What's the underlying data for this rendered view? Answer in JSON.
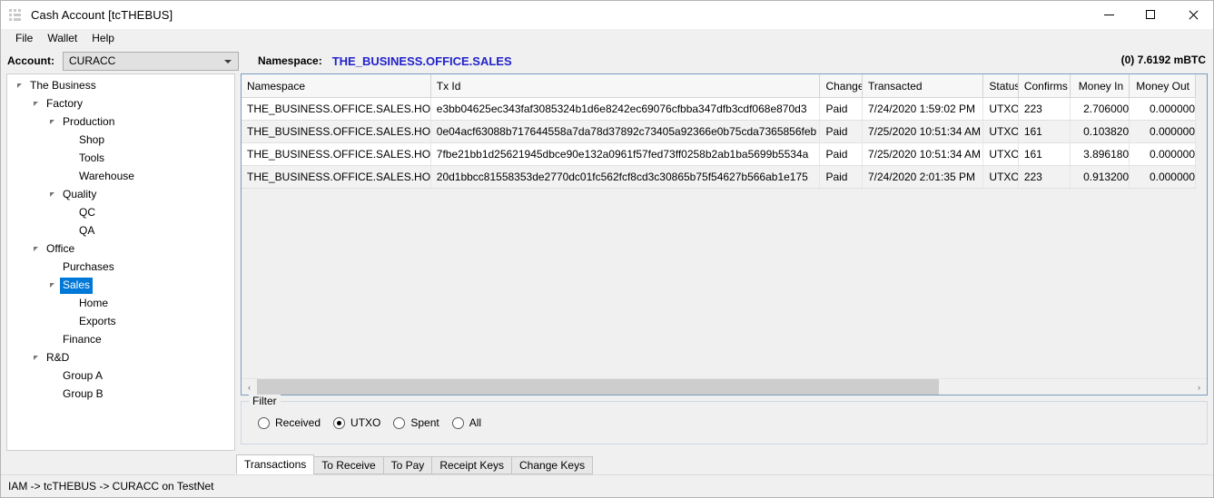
{
  "window": {
    "title": "Cash Account [tcTHEBUS]",
    "icon": "app-grid-icon",
    "minimize": "—",
    "maximize": "□",
    "close": "✕"
  },
  "menubar": {
    "items": [
      {
        "label": "File"
      },
      {
        "label": "Wallet"
      },
      {
        "label": "Help"
      }
    ]
  },
  "toolbar": {
    "account_label": "Account:",
    "account_value": "CURACC",
    "namespace_label": "Namespace:",
    "namespace_value": "THE_BUSINESS.OFFICE.SALES",
    "balance": "(0) 7.6192 mBTC",
    "namespace_color": "#2222cc"
  },
  "tree": {
    "nodes": [
      {
        "label": "The Business",
        "depth": 0,
        "expander": true,
        "selected": false
      },
      {
        "label": "Factory",
        "depth": 1,
        "expander": true,
        "selected": false
      },
      {
        "label": "Production",
        "depth": 2,
        "expander": true,
        "selected": false
      },
      {
        "label": "Shop",
        "depth": 3,
        "expander": false,
        "selected": false
      },
      {
        "label": "Tools",
        "depth": 3,
        "expander": false,
        "selected": false
      },
      {
        "label": "Warehouse",
        "depth": 3,
        "expander": false,
        "selected": false
      },
      {
        "label": "Quality",
        "depth": 2,
        "expander": true,
        "selected": false
      },
      {
        "label": "QC",
        "depth": 3,
        "expander": false,
        "selected": false
      },
      {
        "label": "QA",
        "depth": 3,
        "expander": false,
        "selected": false
      },
      {
        "label": "Office",
        "depth": 1,
        "expander": true,
        "selected": false
      },
      {
        "label": "Purchases",
        "depth": 2,
        "expander": false,
        "selected": false
      },
      {
        "label": "Sales",
        "depth": 2,
        "expander": true,
        "selected": true
      },
      {
        "label": "Home",
        "depth": 3,
        "expander": false,
        "selected": false
      },
      {
        "label": "Exports",
        "depth": 3,
        "expander": false,
        "selected": false
      },
      {
        "label": "Finance",
        "depth": 2,
        "expander": false,
        "selected": false
      },
      {
        "label": "R&D",
        "depth": 1,
        "expander": true,
        "selected": false
      },
      {
        "label": "Group A",
        "depth": 2,
        "expander": false,
        "selected": false
      },
      {
        "label": "Group B",
        "depth": 2,
        "expander": false,
        "selected": false
      }
    ],
    "selection_color": "#0078d7"
  },
  "grid": {
    "columns": [
      {
        "label": "Namespace",
        "align": "left"
      },
      {
        "label": "Tx Id",
        "align": "left"
      },
      {
        "label": "Change",
        "align": "left"
      },
      {
        "label": "Transacted",
        "align": "left"
      },
      {
        "label": "Status",
        "align": "left"
      },
      {
        "label": "Confirms",
        "align": "left"
      },
      {
        "label": "Money In",
        "align": "right"
      },
      {
        "label": "Money Out",
        "align": "right"
      }
    ],
    "rows": [
      {
        "namespace": "THE_BUSINESS.OFFICE.SALES.HOME",
        "txid": "e3bb04625ec343faf3085324b1d6e8242ec69076cfbba347dfb3cdf068e870d3",
        "change": "Paid",
        "transacted": "7/24/2020 1:59:02 PM",
        "status": "UTXO",
        "confirms": "223",
        "money_in": "2.706000",
        "money_out": "0.000000"
      },
      {
        "namespace": "THE_BUSINESS.OFFICE.SALES.HOME",
        "txid": "0e04acf63088b717644558a7da78d37892c73405a92366e0b75cda7365856feb",
        "change": "Paid",
        "transacted": "7/25/2020 10:51:34 AM",
        "status": "UTXO",
        "confirms": "161",
        "money_in": "0.103820",
        "money_out": "0.000000"
      },
      {
        "namespace": "THE_BUSINESS.OFFICE.SALES.HOME",
        "txid": "7fbe21bb1d25621945dbce90e132a0961f57fed73ff0258b2ab1ba5699b5534a",
        "change": "Paid",
        "transacted": "7/25/2020 10:51:34 AM",
        "status": "UTXO",
        "confirms": "161",
        "money_in": "3.896180",
        "money_out": "0.000000"
      },
      {
        "namespace": "THE_BUSINESS.OFFICE.SALES.HOME",
        "txid": "20d1bbcc81558353de2770dc01fc562fcf8cd3c30865b75f54627b566ab1e175",
        "change": "Paid",
        "transacted": "7/24/2020 2:01:35 PM",
        "status": "UTXO",
        "confirms": "223",
        "money_in": "0.913200",
        "money_out": "0.000000"
      }
    ],
    "scroll_left_arrow": "‹",
    "scroll_right_arrow": "›"
  },
  "filter": {
    "legend": "Filter",
    "options": [
      {
        "label": "Received",
        "selected": false
      },
      {
        "label": "UTXO",
        "selected": true
      },
      {
        "label": "Spent",
        "selected": false
      },
      {
        "label": "All",
        "selected": false
      }
    ]
  },
  "tabs": [
    {
      "label": "Transactions",
      "active": true
    },
    {
      "label": "To Receive",
      "active": false
    },
    {
      "label": "To Pay",
      "active": false
    },
    {
      "label": "Receipt Keys",
      "active": false
    },
    {
      "label": "Change Keys",
      "active": false
    }
  ],
  "statusbar": {
    "text": "IAM -> tcTHEBUS -> CURACC on TestNet"
  }
}
